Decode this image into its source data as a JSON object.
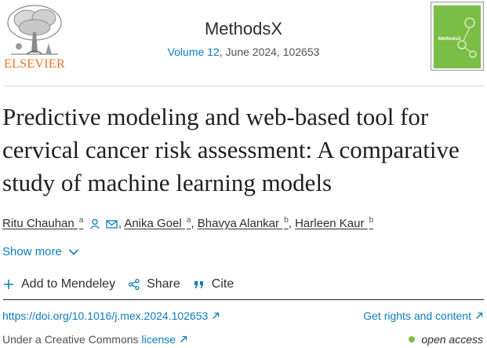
{
  "header": {
    "publisher": "ELSEVIER",
    "journal_title": "MethodsX",
    "volume_link": "Volume 12",
    "issue_details": ", June 2024, 102653",
    "cover_label": "MethodsX"
  },
  "article": {
    "title": "Predictive modeling and web-based tool for cervical cancer risk assessment: A comparative study of machine learning models"
  },
  "authors": [
    {
      "name": "Ritu Chauhan",
      "affiliation": "a",
      "has_person_icon": true,
      "has_email_icon": true
    },
    {
      "name": "Anika Goel",
      "affiliation": "a"
    },
    {
      "name": "Bhavya Alankar",
      "affiliation": "b"
    },
    {
      "name": "Harleen Kaur",
      "affiliation": "b"
    }
  ],
  "separators": {
    "comma": ", "
  },
  "show_more": {
    "label": "Show more",
    "icon": "chevron-down-icon"
  },
  "actions": {
    "mendeley": {
      "label": "Add to Mendeley",
      "icon": "plus-icon"
    },
    "share": {
      "label": "Share",
      "icon": "share-icon"
    },
    "cite": {
      "label": "Cite",
      "icon": "quote-icon"
    }
  },
  "links": {
    "doi": "https://doi.org/10.1016/j.mex.2024.102653",
    "rights": "Get rights and content"
  },
  "license": {
    "prefix": "Under a Creative Commons",
    "link": "license",
    "open_access": "open access"
  },
  "colors": {
    "link": "#0c7dbb",
    "text": "#2e2e2e",
    "elsevier_orange": "#e9711c",
    "open_access_green": "#7bbe45"
  }
}
